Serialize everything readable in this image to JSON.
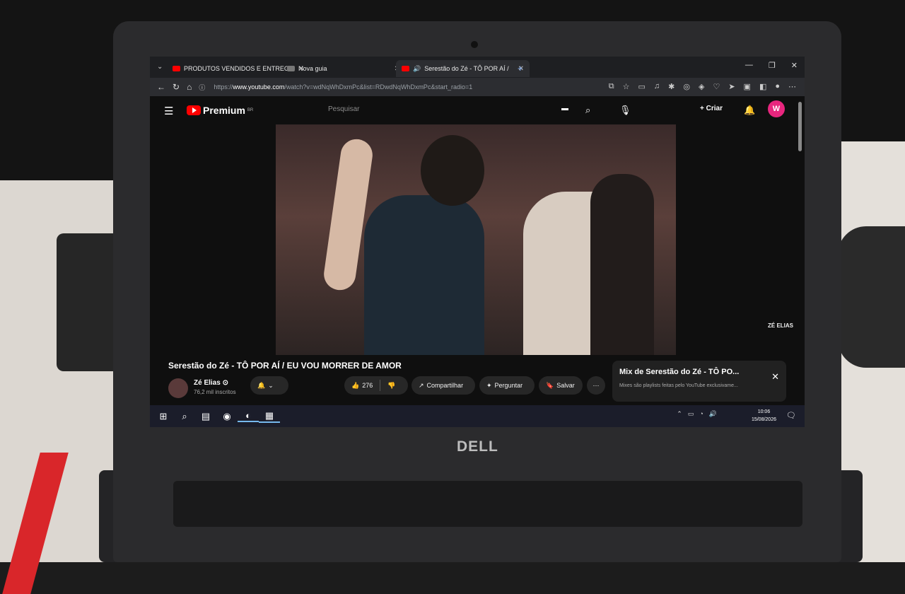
{
  "tabs": [
    {
      "label": "PRODUTOS VENDIDOS E ENTREG",
      "active": false
    },
    {
      "label": "Nova guia",
      "active": false
    },
    {
      "label": "Serestão do Zé - TÔ POR AÍ /",
      "active": true
    }
  ],
  "address": {
    "url_prefix": "https://",
    "url_host": "www.youtube.com",
    "url_path": "/watch?v=wdNqWhDxmPc&list=RDwdNqWhDxmPc&start_radio=1"
  },
  "youtube": {
    "logo_text": "Premium",
    "logo_region": "BR",
    "search_placeholder": "Pesquisar",
    "create_label": "+ Criar",
    "avatar_letter": "W"
  },
  "video": {
    "title": "Serestão do Zé - TÔ POR AÍ / EU VOU MORRER DE AMOR",
    "watermark": "ZÉ ELIAS",
    "channel_name": "Zé Elias ⊙",
    "channel_subs": "76,2 mil inscritos",
    "like_count": "276",
    "share_label": "Compartilhar",
    "ask_label": "Perguntar",
    "save_label": "Salvar"
  },
  "mix": {
    "title": "Mix de Serestão do Zé - TÔ PO...",
    "subtitle": "Mixes são playlists feitas pelo YouTube exclusivame..."
  },
  "taskbar": {
    "time": "10:06",
    "date": "15/08/2026"
  }
}
